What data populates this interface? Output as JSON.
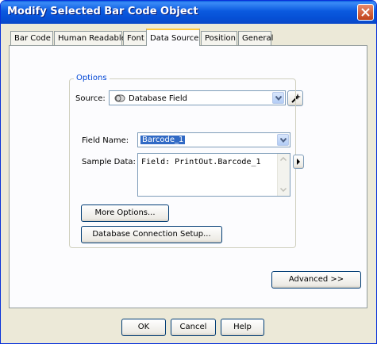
{
  "window": {
    "title": "Modify Selected Bar Code Object"
  },
  "tabs": [
    {
      "label": "Bar Code"
    },
    {
      "label": "Human Readable"
    },
    {
      "label": "Font"
    },
    {
      "label": "Data Source",
      "active": true
    },
    {
      "label": "Position"
    },
    {
      "label": "General"
    }
  ],
  "source": {
    "label": "Source:",
    "value": "Database Field",
    "icon": "database-icon"
  },
  "options": {
    "legend": "Options",
    "field_name_label": "Field Name:",
    "field_name_value": "Barcode_1",
    "sample_data_label": "Sample Data:",
    "sample_data_value": "Field: PrintOut.Barcode_1",
    "more_options_label": "More Options...",
    "db_setup_label": "Database Connection Setup..."
  },
  "advanced_label": "Advanced >>",
  "footer": {
    "ok": "OK",
    "cancel": "Cancel",
    "help": "Help"
  },
  "colors": {
    "titlebar": "#0a5fe0",
    "selection": "#316ac5",
    "legend": "#0046d5",
    "tab_highlight": "#ffc83c"
  }
}
